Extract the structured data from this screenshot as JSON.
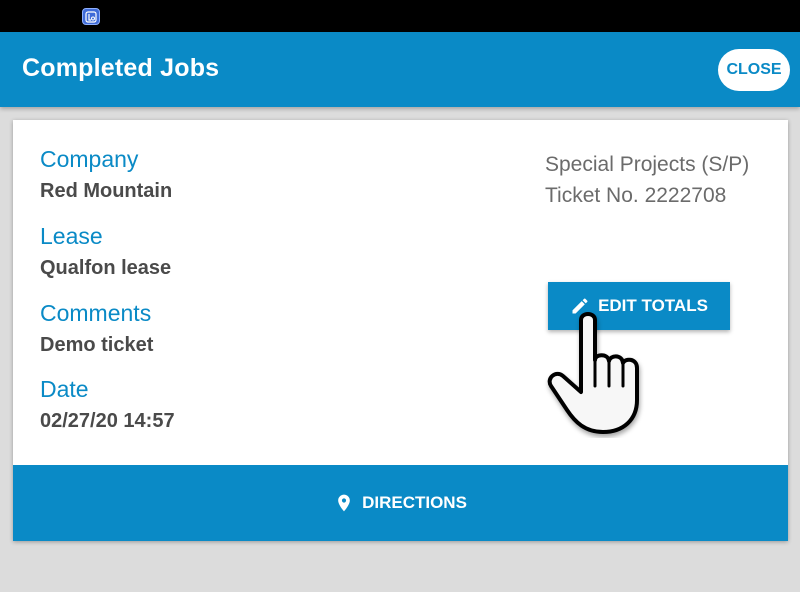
{
  "status_bar": {
    "app_icon": "launcher-app-icon"
  },
  "header": {
    "title": "Completed Jobs",
    "close_label": "CLOSE"
  },
  "job": {
    "company_label": "Company",
    "company_value": "Red Mountain",
    "lease_label": "Lease",
    "lease_value": "Qualfon lease",
    "comments_label": "Comments",
    "comments_value": "Demo ticket",
    "date_label": "Date",
    "date_value": "02/27/20 14:57",
    "category": "Special Projects (S/P)",
    "ticket": "Ticket No. 2222708"
  },
  "actions": {
    "edit_totals_label": "EDIT TOTALS",
    "edit_icon": "pencil-icon",
    "directions_label": "DIRECTIONS",
    "directions_icon": "map-pin-icon"
  },
  "colors": {
    "primary": "#0a8ac6",
    "label_text": "#0a8ac6",
    "value_text": "#4a4a4a",
    "secondary_text": "#6b6b6b"
  }
}
